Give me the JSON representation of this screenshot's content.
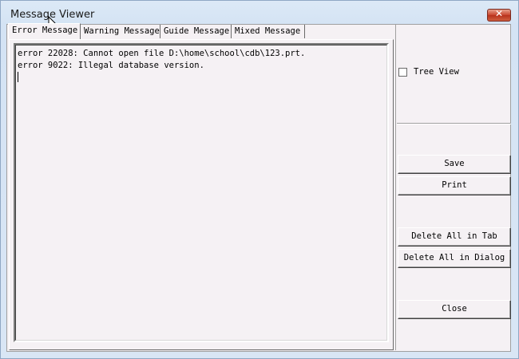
{
  "window": {
    "title": "Message Viewer",
    "close_symbol": "✕"
  },
  "tabs": [
    {
      "label": "Error Message",
      "active": true
    },
    {
      "label": "Warning Message",
      "active": false
    },
    {
      "label": "Guide Message",
      "active": false
    },
    {
      "label": "Mixed Message",
      "active": false
    }
  ],
  "messages": [
    "error 22028: Cannot open file D:\\home\\school\\cdb\\123.prt.",
    "error 9022: Illegal database version."
  ],
  "tree_view": {
    "label": "Tree View",
    "checked": false
  },
  "buttons": {
    "save": "Save",
    "print": "Print",
    "delete_all_tab": "Delete All in Tab",
    "delete_all_dialog": "Delete All in Dialog",
    "close": "Close"
  },
  "icons": {
    "cursor": "mouse-pointer-icon",
    "close": "close-icon"
  }
}
